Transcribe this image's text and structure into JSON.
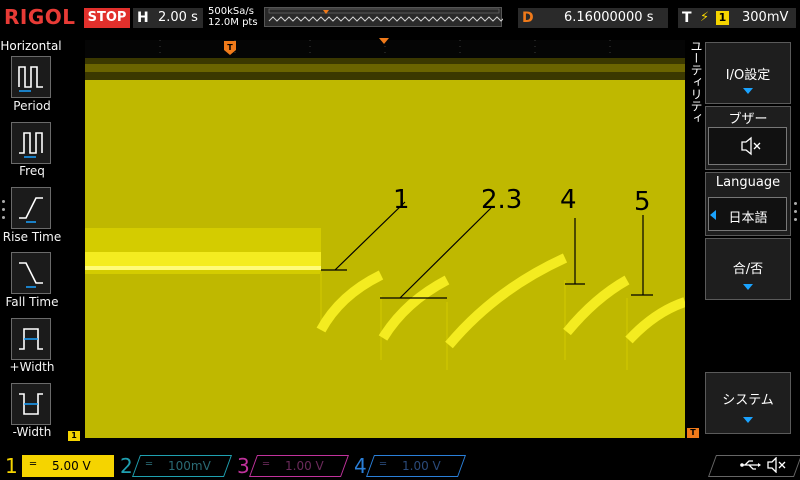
{
  "top": {
    "logo": "RIGOL",
    "run_status": "STOP",
    "timebase_key": "H",
    "timebase_value": "2.00 s",
    "sample_rate": "500kSa/s",
    "memory_depth": "12.0M pts",
    "delay_key": "D",
    "delay_value": "6.16000000 s",
    "trigger_key": "T",
    "trigger_edge_icon": "rising-edge-icon",
    "trigger_source": "1",
    "trigger_level": "300mV"
  },
  "left_menu": {
    "title": "Horizontal",
    "items": [
      {
        "label": "Period",
        "icon": "period-icon"
      },
      {
        "label": "Freq",
        "icon": "frequency-icon"
      },
      {
        "label": "Rise Time",
        "icon": "rise-time-icon"
      },
      {
        "label": "Fall Time",
        "icon": "fall-time-icon"
      },
      {
        "label": "+Width",
        "icon": "positive-width-icon"
      },
      {
        "label": "-Width",
        "icon": "negative-width-icon"
      }
    ]
  },
  "screen": {
    "utility_label": "ユーティリティ",
    "ch1_marker": "1",
    "trig_marker": "T",
    "annotations": [
      "1",
      "2.3",
      "4",
      "5"
    ]
  },
  "right_menu": {
    "io_label": "I/O設定",
    "buzzer_label": "ブザー",
    "buzzer_icon": "speaker-mute-icon",
    "language_label": "Language",
    "language_value": "日本語",
    "pass_fail_label": "合/否",
    "system_label": "システム"
  },
  "bottom": {
    "channels": [
      {
        "num": "1",
        "scale": "5.00 V",
        "color": "#f5d400",
        "active": true
      },
      {
        "num": "2",
        "scale": "100mV",
        "color": "#1fa0b0",
        "active": false
      },
      {
        "num": "3",
        "scale": "1.00 V",
        "color": "#c0329c",
        "active": false
      },
      {
        "num": "4",
        "scale": "1.00 V",
        "color": "#2a7fd8",
        "active": false
      }
    ],
    "usb_icon": "usb-icon",
    "sound_icon": "speaker-mute-icon"
  },
  "colors": {
    "ch1": "#f5d400",
    "background_fill": "#bfb800",
    "accent_blue": "#1aa3ff",
    "trigger_orange": "#f07a1a",
    "stop_red": "#e1302c"
  }
}
